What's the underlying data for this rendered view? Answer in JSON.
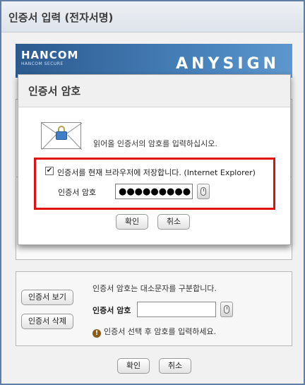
{
  "window": {
    "title": "인증서 입력 (전자서명)"
  },
  "banner": {
    "logo": "HANCOM",
    "sub": "HANCOM SECURE",
    "brand": "ANYSIGN"
  },
  "bottom": {
    "info": "인증서 암호는 대소문자를 구분합니다.",
    "view_cert": "인증서 보기",
    "delete_cert": "인증서 삭제",
    "pw_label": "인증서 암호",
    "pw_value": "",
    "warning": "인증서 선택 후 암호를 입력하세요.",
    "ok": "확인",
    "cancel": "취소"
  },
  "modal": {
    "title": "인증서 암호",
    "message": "읽어올 인증서의 암호를 입력하십시오.",
    "save_checkbox_checked": true,
    "save_label": "인증서를 현재 브라우저에 저장합니다. (Internet Explorer)",
    "pw_label": "인증서 암호",
    "pw_masked": "●●●●●●●●●",
    "ok": "확인",
    "cancel": "취소"
  },
  "icons": {
    "warning": "exclamation-icon",
    "mouse": "mouse-icon",
    "envelope": "envelope-lock-icon"
  },
  "colors": {
    "highlight": "#e01010",
    "frame": "#5f7fa6",
    "banner": "#2b5a8e"
  }
}
